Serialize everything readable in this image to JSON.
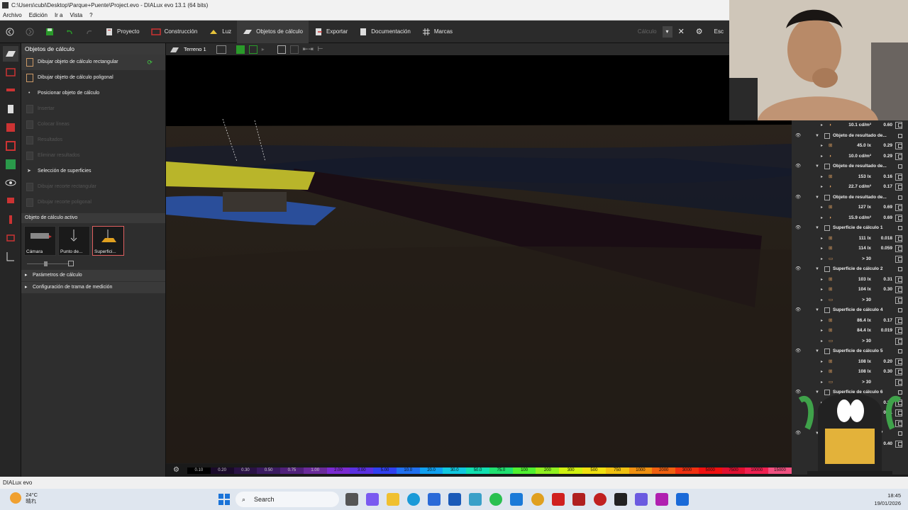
{
  "window": {
    "title": "C:\\Users\\cubi\\Desktop\\Parque+Puente\\Project.evo - DIALux evo 13.1  (64 bits)"
  },
  "menu": [
    "Archivo",
    "Edición",
    "Ir a",
    "Vista",
    "?"
  ],
  "toolbar": {
    "tabs": [
      {
        "label": "Proyecto"
      },
      {
        "label": "Construcción"
      },
      {
        "label": "Luz"
      },
      {
        "label": "Objetos de cálculo"
      },
      {
        "label": "Exportar"
      },
      {
        "label": "Documentación"
      },
      {
        "label": "Marcas"
      }
    ],
    "calc_label": "Cálculo",
    "esc_label": "Esc"
  },
  "left_panel": {
    "header": "Objetos de cálculo",
    "items": [
      {
        "label": "Dibujar objeto de cálculo rectangular",
        "enabled": true
      },
      {
        "label": "Dibujar objeto de cálculo poligonal",
        "enabled": true
      },
      {
        "label": "Posicionar objeto de cálculo",
        "enabled": true
      },
      {
        "label": "Insertar",
        "enabled": false
      },
      {
        "label": "Colocar líneas",
        "enabled": false
      },
      {
        "label": "Resultados",
        "enabled": false
      },
      {
        "label": "Eliminar resultados",
        "enabled": false
      },
      {
        "label": "Selección de superficies",
        "enabled": true
      },
      {
        "label": "Dibujar recorte rectangular",
        "enabled": false
      },
      {
        "label": "Dibujar recorte poligonal",
        "enabled": false
      }
    ],
    "active_header": "Objeto de cálculo activo",
    "thumbs": [
      {
        "label": "Cámara",
        "selected": false
      },
      {
        "label": "Punto de...",
        "selected": false
      },
      {
        "label": "Superfici...",
        "selected": true
      }
    ],
    "sections": [
      "Parámetros de cálculo",
      "Configuración de trama de medición"
    ]
  },
  "view_toolbar": {
    "terrain_label": "Terreno 1"
  },
  "scale": {
    "values": [
      "0.10",
      "0.20",
      "0.30",
      "0.50",
      "0.75",
      "1.00",
      "2.00",
      "3.00",
      "5.00",
      "10.0",
      "20.0",
      "30.0",
      "50.0",
      "75.0",
      "100",
      "200",
      "300",
      "500",
      "750",
      "1000",
      "2000",
      "3000",
      "5000",
      "7500",
      "10000",
      "15000"
    ],
    "colors": [
      "#000000",
      "#1a0a2a",
      "#2a1245",
      "#3a1a60",
      "#50207a",
      "#6a2a9a",
      "#7a2ad0",
      "#5a30e0",
      "#3040f0",
      "#2070f0",
      "#10a0f0",
      "#10c8e0",
      "#10e0b0",
      "#20e070",
      "#50f030",
      "#90f020",
      "#d0f010",
      "#f0e010",
      "#f0c010",
      "#f09010",
      "#f06010",
      "#f03010",
      "#f01010",
      "#e01030",
      "#f02050",
      "#f05080"
    ]
  },
  "right_panel": {
    "rows": [
      {
        "type": "val",
        "icon": "luminance",
        "v1": "10.1 cd/m²",
        "v2": "0.60"
      },
      {
        "type": "group",
        "name": "Objeto de resultado de..."
      },
      {
        "type": "val",
        "icon": "illuminance",
        "v1": "45.0 lx",
        "v2": "0.29"
      },
      {
        "type": "val",
        "icon": "luminance",
        "v1": "10.0 cd/m²",
        "v2": "0.29"
      },
      {
        "type": "group",
        "name": "Objeto de resultado de..."
      },
      {
        "type": "val",
        "icon": "illuminance",
        "v1": "153 lx",
        "v2": "0.16"
      },
      {
        "type": "val",
        "icon": "luminance",
        "v1": "22.7 cd/m²",
        "v2": "0.17"
      },
      {
        "type": "group",
        "name": "Objeto de resultado de..."
      },
      {
        "type": "val",
        "icon": "illuminance",
        "v1": "127 lx",
        "v2": "0.69"
      },
      {
        "type": "val",
        "icon": "luminance",
        "v1": "15.9 cd/m²",
        "v2": "0.69"
      },
      {
        "type": "group",
        "name": "Superficie de cálculo 1"
      },
      {
        "type": "val",
        "icon": "illuminance",
        "v1": "111 lx",
        "v2": "0.018"
      },
      {
        "type": "val",
        "icon": "illuminance",
        "v1": "114 lx",
        "v2": "0.059"
      },
      {
        "type": "val",
        "icon": "ugr",
        "v1": "> 30",
        "v2": ""
      },
      {
        "type": "group",
        "name": "Superficie de cálculo 2"
      },
      {
        "type": "val",
        "icon": "illuminance",
        "v1": "103 lx",
        "v2": "0.31"
      },
      {
        "type": "val",
        "icon": "illuminance",
        "v1": "104 lx",
        "v2": "0.30"
      },
      {
        "type": "val",
        "icon": "ugr",
        "v1": "> 30",
        "v2": ""
      },
      {
        "type": "group",
        "name": "Superficie de cálculo 4"
      },
      {
        "type": "val",
        "icon": "illuminance",
        "v1": "86.4 lx",
        "v2": "0.17"
      },
      {
        "type": "val",
        "icon": "illuminance",
        "v1": "84.4 lx",
        "v2": "0.019"
      },
      {
        "type": "val",
        "icon": "ugr",
        "v1": "> 30",
        "v2": ""
      },
      {
        "type": "group",
        "name": "Superficie de cálculo 5"
      },
      {
        "type": "val",
        "icon": "illuminance",
        "v1": "108 lx",
        "v2": "0.20"
      },
      {
        "type": "val",
        "icon": "illuminance",
        "v1": "108 lx",
        "v2": "0.30"
      },
      {
        "type": "val",
        "icon": "ugr",
        "v1": "> 30",
        "v2": ""
      },
      {
        "type": "group",
        "name": "Superficie de cálculo 6"
      },
      {
        "type": "val",
        "icon": "illuminance",
        "v1": "",
        "v2": "0.28"
      },
      {
        "type": "val",
        "icon": "illuminance",
        "v1": "",
        "v2": "0.41"
      },
      {
        "type": "val",
        "icon": "ugr",
        "v1": "",
        "v2": ""
      },
      {
        "type": "group",
        "name": "Superficie de cálculo 7"
      },
      {
        "type": "val",
        "icon": "illuminance",
        "v1": "",
        "v2": "0.40"
      }
    ]
  },
  "statusbar": {
    "text": "DIALux evo"
  },
  "taskbar": {
    "weather_temp": "24°C",
    "weather_desc": "晴れ",
    "search_label": "Search",
    "time": "18:45",
    "date": "19/01/2026"
  }
}
